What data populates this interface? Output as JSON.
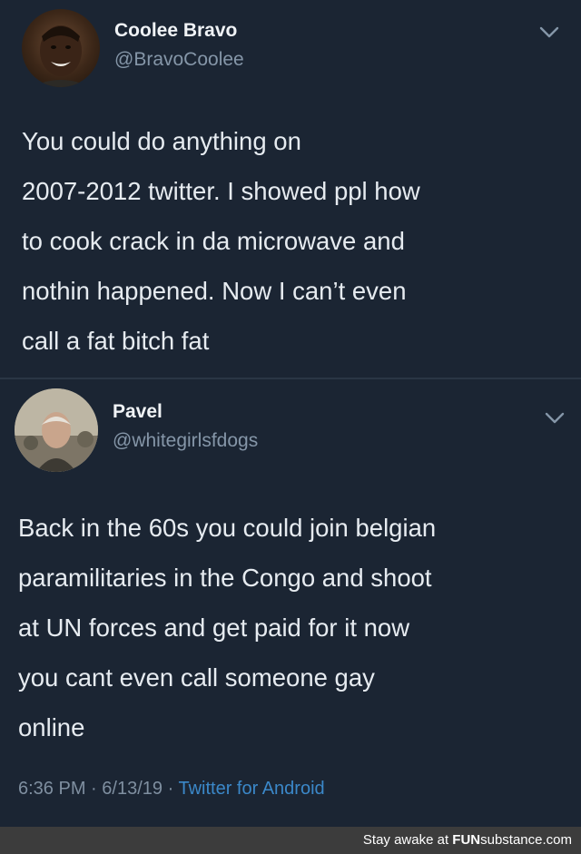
{
  "tweets": [
    {
      "display_name": "Coolee Bravo",
      "handle": "@BravoCoolee",
      "avatar_icon": "profile-photo",
      "menu_icon": "chevron-down-icon",
      "lines": [
        "You could do anything on",
        "2007-2012 twitter. I showed ppl how",
        "to cook crack in da microwave and",
        "nothin happened. Now I can’t even",
        "call a fat bitch fat"
      ]
    },
    {
      "display_name": "Pavel",
      "handle": "@whitegirlsfdogs",
      "avatar_icon": "profile-photo",
      "menu_icon": "chevron-down-icon",
      "lines": [
        "Back in the 60s you could join belgian",
        "paramilitaries in the Congo and shoot",
        "at UN forces and get paid for it now",
        "you cant even call someone gay",
        "online"
      ],
      "meta": {
        "time": "6:36 PM",
        "date": "6/13/19",
        "separator": "·",
        "app": "Twitter for Android"
      }
    }
  ],
  "footer": {
    "prefix": "Stay awake at ",
    "brand_bold": "FUN",
    "brand_rest": "substance.com"
  },
  "colors": {
    "background": "#1b2533",
    "link": "#3b88c9",
    "secondary_text": "#8596a8"
  }
}
